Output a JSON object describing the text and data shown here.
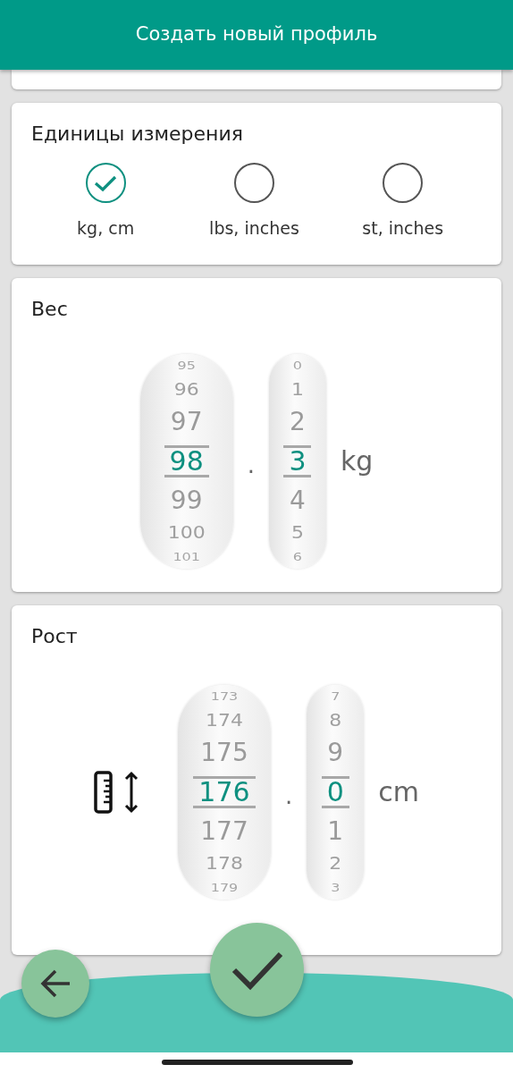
{
  "header": {
    "title": "Создать новый профиль"
  },
  "units": {
    "title": "Единицы измерения",
    "options": [
      {
        "label": "kg, cm",
        "selected": true
      },
      {
        "label": "lbs, inches",
        "selected": false
      },
      {
        "label": "st, inches",
        "selected": false
      }
    ]
  },
  "pickers": [
    {
      "kind": "weight",
      "title": "Вес",
      "unit": "kg",
      "separator": ".",
      "wheels": [
        {
          "values": [
            {
              "text": "95",
              "selected": false
            },
            {
              "text": "96",
              "selected": false
            },
            {
              "text": "97",
              "selected": false
            },
            {
              "text": "98",
              "selected": true
            },
            {
              "text": "99",
              "selected": false
            },
            {
              "text": "100",
              "selected": false
            },
            {
              "text": "101",
              "selected": false
            }
          ]
        },
        {
          "values": [
            {
              "text": "0",
              "selected": false
            },
            {
              "text": "1",
              "selected": false
            },
            {
              "text": "2",
              "selected": false
            },
            {
              "text": "3",
              "selected": true
            },
            {
              "text": "4",
              "selected": false
            },
            {
              "text": "5",
              "selected": false
            },
            {
              "text": "6",
              "selected": false
            }
          ]
        }
      ]
    },
    {
      "kind": "height",
      "title": "Рост",
      "unit": "cm",
      "separator": ".",
      "wheels": [
        {
          "values": [
            {
              "text": "173",
              "selected": false
            },
            {
              "text": "174",
              "selected": false
            },
            {
              "text": "175",
              "selected": false
            },
            {
              "text": "176",
              "selected": true
            },
            {
              "text": "177",
              "selected": false
            },
            {
              "text": "178",
              "selected": false
            },
            {
              "text": "179",
              "selected": false
            }
          ]
        },
        {
          "values": [
            {
              "text": "7",
              "selected": false
            },
            {
              "text": "8",
              "selected": false
            },
            {
              "text": "9",
              "selected": false
            },
            {
              "text": "0",
              "selected": true
            },
            {
              "text": "1",
              "selected": false
            },
            {
              "text": "2",
              "selected": false
            },
            {
              "text": "3",
              "selected": false
            }
          ]
        }
      ]
    }
  ]
}
